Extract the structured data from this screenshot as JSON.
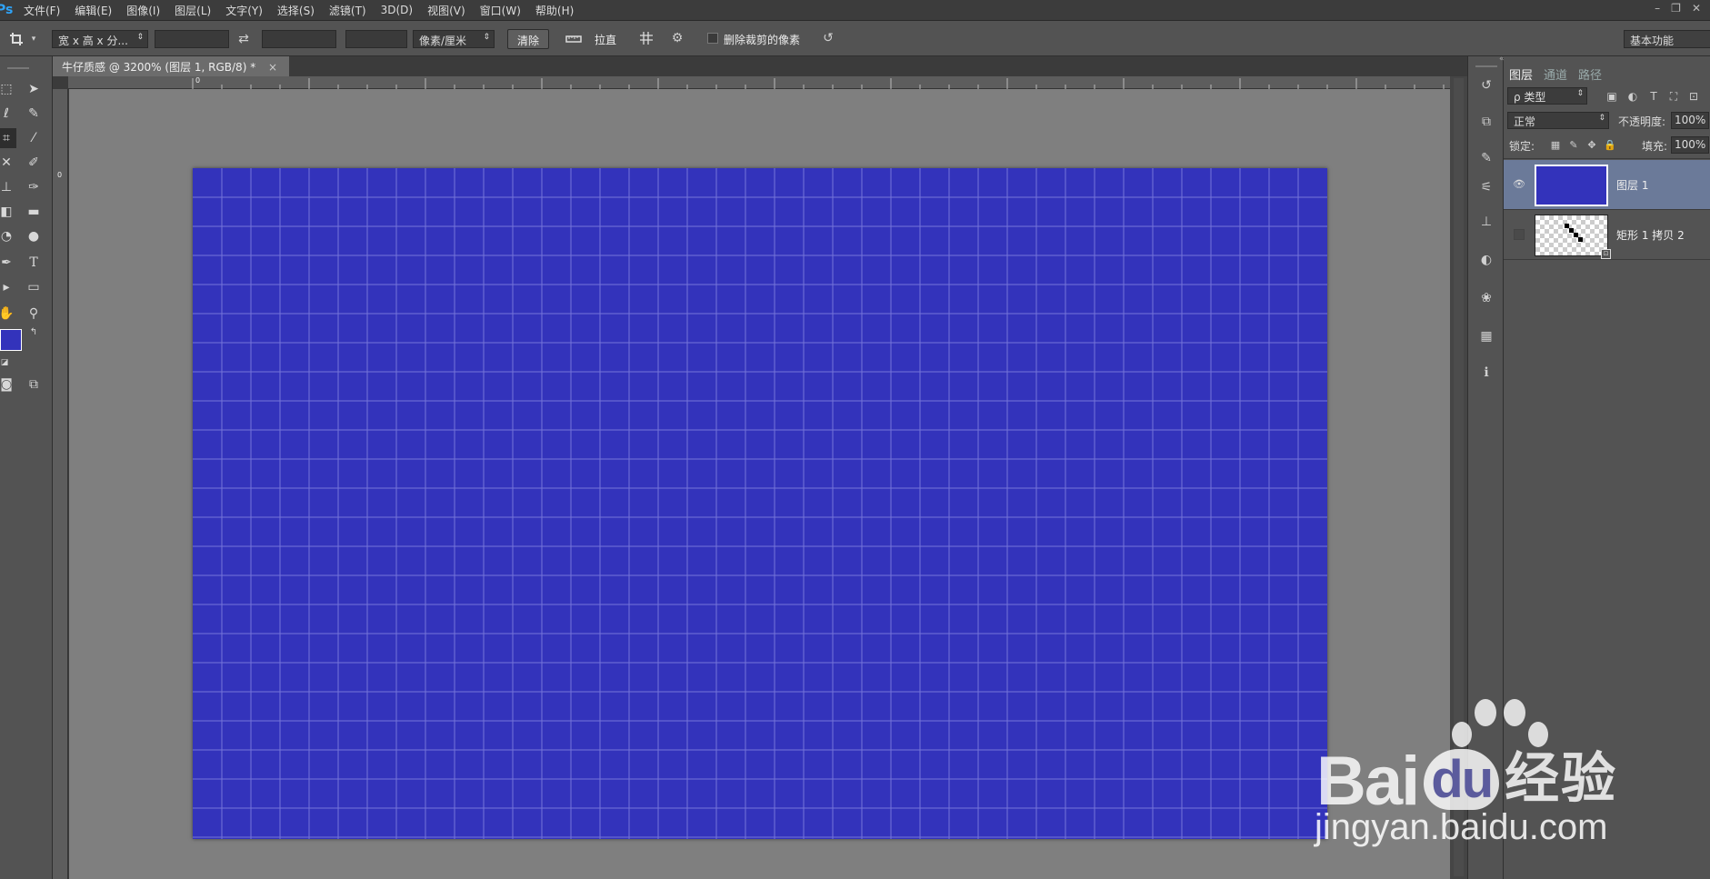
{
  "app": {
    "logo": "Ps"
  },
  "menu": [
    "文件(F)",
    "编辑(E)",
    "图像(I)",
    "图层(L)",
    "文字(Y)",
    "选择(S)",
    "滤镜(T)",
    "3D(D)",
    "视图(V)",
    "窗口(W)",
    "帮助(H)"
  ],
  "window_controls": {
    "minimize": "–",
    "restore": "❐",
    "close": "✕"
  },
  "options": {
    "tool_icon": "crop-icon",
    "ratio_select": "宽 x 高 x 分...",
    "width_value": "",
    "height_value": "",
    "resolution_value": "",
    "unit_select": "像素/厘米",
    "clear_button": "清除",
    "straighten_label": "拉直",
    "delete_cropped_label": "删除裁剪的像素",
    "delete_cropped_checked": false,
    "workspace_select": "基本功能"
  },
  "document": {
    "tab_title": "牛仔质感 @ 3200% (图层 1, RGB/8) *",
    "tab_close": "×",
    "ruler_h_zero": "0",
    "ruler_v_zero": "0",
    "canvas_color": "#3333bb",
    "grid_color": "#7575d8"
  },
  "toolbox": {
    "foreground_color": "#3333bb",
    "background_color": "#ffffff"
  },
  "layers_panel": {
    "tabs": [
      "图层",
      "通道",
      "路径"
    ],
    "active_tab": "图层",
    "filter_kind": "ρ 类型",
    "blend_mode": "正常",
    "opacity_label": "不透明度:",
    "opacity_value": "100%",
    "lock_label": "锁定:",
    "fill_label": "填充:",
    "fill_value": "100%",
    "layers": [
      {
        "name": "图层 1",
        "visible": true,
        "selected": true,
        "thumb_color": "#3333bb"
      },
      {
        "name": "矩形 1 拷贝 2",
        "visible": false,
        "selected": false,
        "thumb_color": "transparent"
      }
    ]
  },
  "watermark": {
    "logo_text": "Bai",
    "logo_du": "du",
    "logo_cn": "经验",
    "url": "jingyan.baidu.com"
  }
}
